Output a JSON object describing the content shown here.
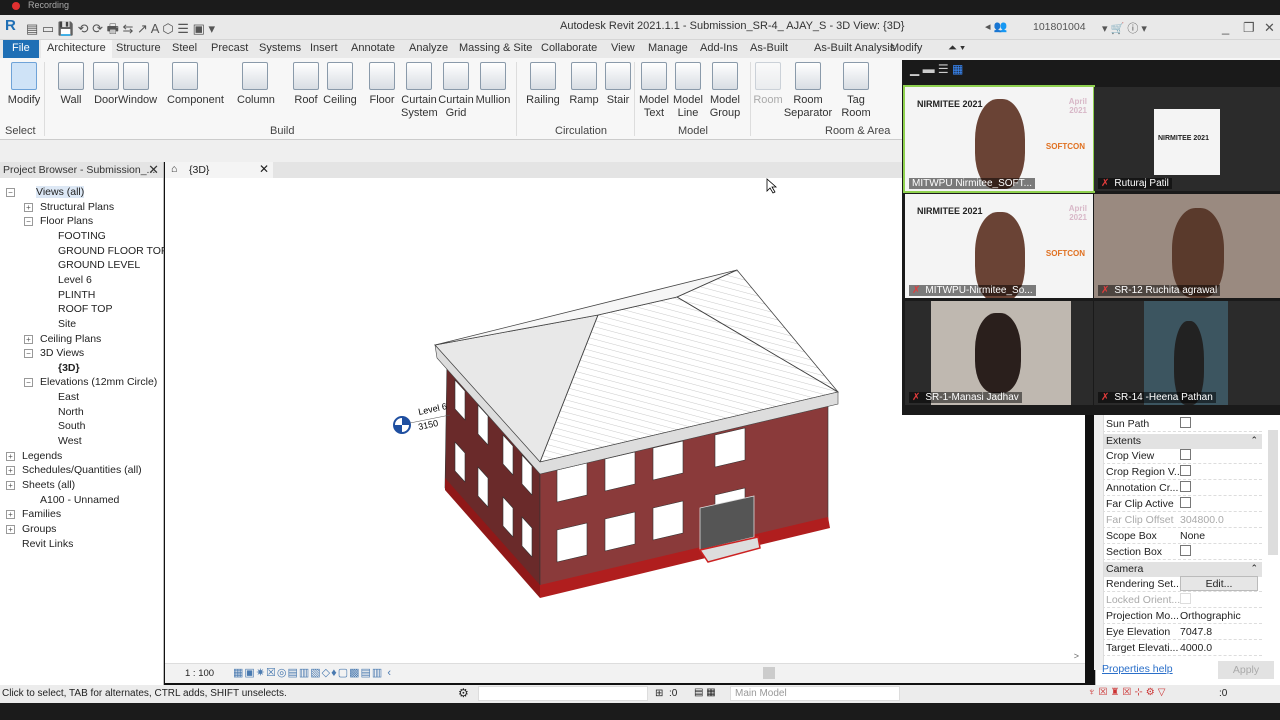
{
  "recording": "Recording",
  "window": {
    "title": "Autodesk Revit 2021.1.1 - Submission_SR-4_ AJAY_S - 3D View: {3D}",
    "user": "101801004"
  },
  "ribbon_tabs": [
    "File",
    "Architecture",
    "Structure",
    "Steel",
    "Precast",
    "Systems",
    "Insert",
    "Annotate",
    "Analyze",
    "Massing & Site",
    "Collaborate",
    "View",
    "Manage",
    "Add-Ins",
    "As-Built",
    "As-Built Analysis",
    "Modify"
  ],
  "tools": [
    {
      "l1": "Modify",
      "l2": ""
    },
    {
      "l1": "Wall",
      "l2": ""
    },
    {
      "l1": "Door",
      "l2": ""
    },
    {
      "l1": "Window",
      "l2": ""
    },
    {
      "l1": "Component",
      "l2": ""
    },
    {
      "l1": "Column",
      "l2": ""
    },
    {
      "l1": "Roof",
      "l2": ""
    },
    {
      "l1": "Ceiling",
      "l2": ""
    },
    {
      "l1": "Floor",
      "l2": ""
    },
    {
      "l1": "Curtain",
      "l2": "System"
    },
    {
      "l1": "Curtain",
      "l2": "Grid"
    },
    {
      "l1": "Mullion",
      "l2": ""
    },
    {
      "l1": "Railing",
      "l2": ""
    },
    {
      "l1": "Ramp",
      "l2": ""
    },
    {
      "l1": "Stair",
      "l2": ""
    },
    {
      "l1": "Model",
      "l2": "Text"
    },
    {
      "l1": "Model",
      "l2": "Line"
    },
    {
      "l1": "Model",
      "l2": "Group"
    },
    {
      "l1": "Room",
      "l2": ""
    },
    {
      "l1": "Room",
      "l2": "Separator"
    },
    {
      "l1": "Tag",
      "l2": "Room"
    }
  ],
  "panels": [
    "Select",
    "Build",
    "Circulation",
    "Model",
    "Room & Area"
  ],
  "browser": {
    "title": "Project Browser - Submission_...",
    "nodes": [
      "Views (all)",
      "Structural Plans",
      "Floor Plans",
      "FOOTING",
      "GROUND FLOOR TOP",
      "GROUND LEVEL",
      "Level 6",
      "PLINTH",
      "ROOF TOP",
      "Site",
      "Ceiling Plans",
      "3D Views",
      "{3D}",
      "Elevations (12mm Circle)",
      "East",
      "North",
      "South",
      "West",
      "Legends",
      "Schedules/Quantities (all)",
      "Sheets (all)",
      "A100 - Unnamed",
      "Families",
      "Groups",
      "Revit Links"
    ]
  },
  "view": {
    "tab": "{3D}",
    "level_label": "Level 6",
    "level_value": "3150",
    "scale": "1 : 100"
  },
  "properties": {
    "rows": [
      {
        "type": "row",
        "k": "Sun Path",
        "v": "",
        "cb": true
      },
      {
        "type": "group",
        "k": "Extents"
      },
      {
        "type": "row",
        "k": "Crop View",
        "cb": true
      },
      {
        "type": "row",
        "k": "Crop Region V...",
        "cb": true
      },
      {
        "type": "row",
        "k": "Annotation Cr...",
        "cb": true
      },
      {
        "type": "row",
        "k": "Far Clip Active",
        "cb": true
      },
      {
        "type": "dis",
        "k": "Far Clip Offset",
        "v": "304800.0"
      },
      {
        "type": "row",
        "k": "Scope Box",
        "v": "None"
      },
      {
        "type": "row",
        "k": "Section Box",
        "cb": true
      },
      {
        "type": "group",
        "k": "Camera"
      },
      {
        "type": "row",
        "k": "Rendering Set...",
        "btn": "Edit..."
      },
      {
        "type": "dis",
        "k": "Locked Orient...",
        "cb": true
      },
      {
        "type": "row",
        "k": "Projection Mo...",
        "v": "Orthographic"
      },
      {
        "type": "row",
        "k": "Eye Elevation",
        "v": "7047.8"
      },
      {
        "type": "row",
        "k": "Target Elevati...",
        "v": "4000.0"
      }
    ],
    "help": "Properties help",
    "apply": "Apply"
  },
  "status": {
    "hint": "Click to select, TAB for alternates, CTRL adds, SHIFT unselects.",
    "model": "Main Model",
    "count": ":0",
    "filter": ":0"
  },
  "video": {
    "participants": [
      "MITWPU Nirmitee_SOFT...",
      "Ruturaj Patil",
      "MITWPU-Nirmitee_So...",
      "SR-12 Ruchita agrawal",
      "SR-1-Manasi Jadhav",
      "SR-14 -Heena Pathan"
    ],
    "banner_logo": "NIRMITEE 2021",
    "banner_sponsor": "SOFTCON",
    "banner_month": "April 2021"
  },
  "colors": {
    "file_tab": "#1f6fb5",
    "active_speaker": "#8fd14f",
    "wall": "#8a3a3a"
  }
}
